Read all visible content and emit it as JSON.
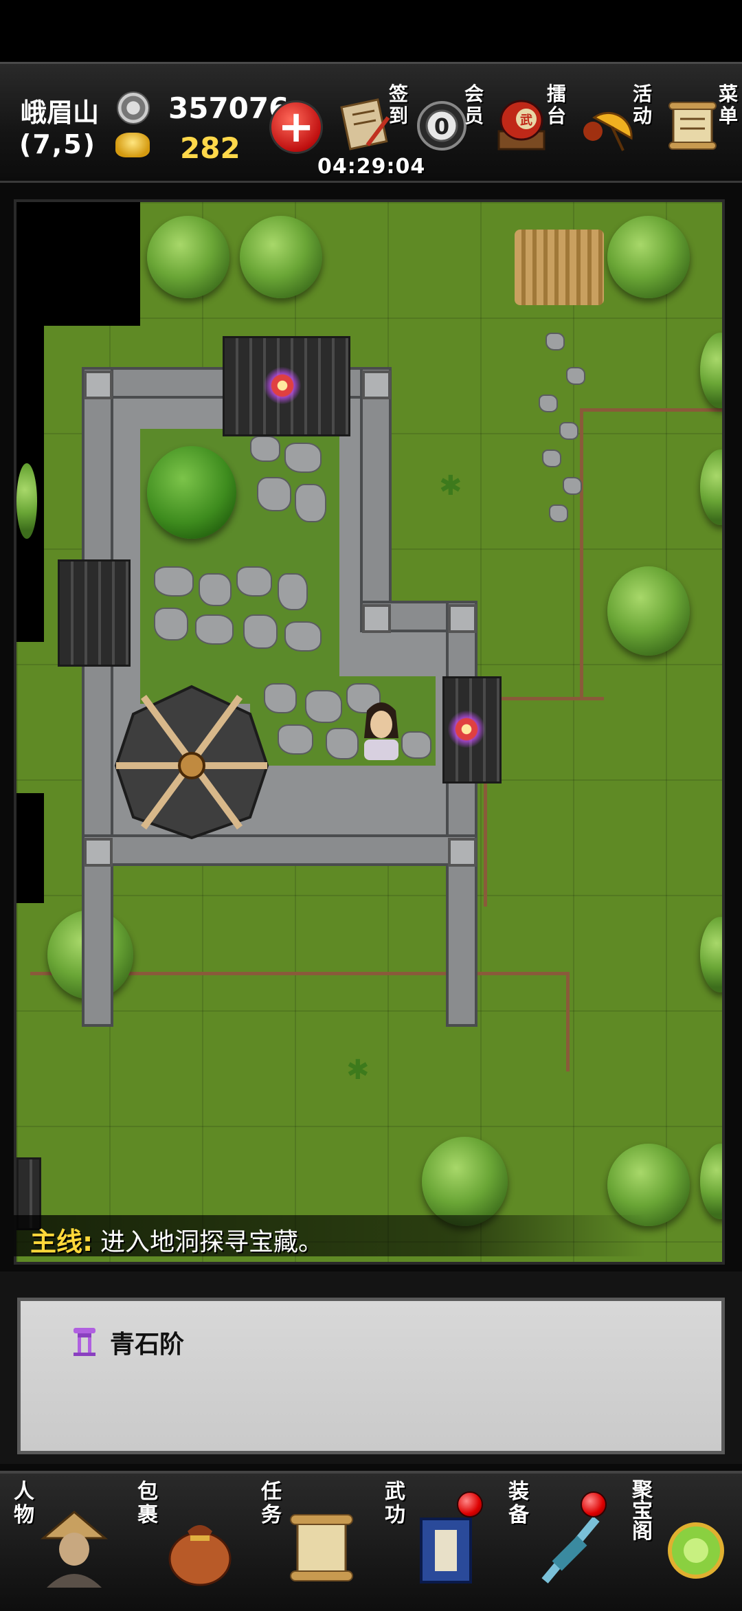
{
  "header": {
    "location_name": "峨眉山",
    "coordinates": "(7,5)",
    "silver_amount": "357076",
    "gold_amount": "282",
    "timer": "04:29:04",
    "menu": [
      {
        "label": "签到",
        "icon": "sign-in-scroll-icon"
      },
      {
        "label": "会员",
        "icon": "vip-medal-icon"
      },
      {
        "label": "擂台",
        "icon": "arena-drum-icon"
      },
      {
        "label": "活动",
        "icon": "event-umbrella-icon"
      },
      {
        "label": "菜单",
        "icon": "menu-scroll-icon"
      }
    ]
  },
  "map": {
    "quest_type": "主线",
    "quest_separator": ":",
    "quest_text": "进入地洞探寻宝藏。"
  },
  "info_panel": {
    "tile_name": "青石阶",
    "icon": "stone-stairs-icon"
  },
  "bottom_nav": [
    {
      "label": "人物",
      "icon": "character-icon",
      "badge": false
    },
    {
      "label": "包裹",
      "icon": "bag-icon",
      "badge": false
    },
    {
      "label": "任务",
      "icon": "quest-scroll-icon",
      "badge": false
    },
    {
      "label": "武功",
      "icon": "martial-arts-book-icon",
      "badge": true
    },
    {
      "label": "装备",
      "icon": "equipment-icon",
      "badge": true
    },
    {
      "label": "聚宝阁",
      "icon": "treasure-pavilion-icon",
      "badge": false
    }
  ],
  "colors": {
    "gold_text": "#ffd84a",
    "quest_label": "#ffd83a",
    "grass": "#5f8a25",
    "badge_red": "#dd0000"
  }
}
